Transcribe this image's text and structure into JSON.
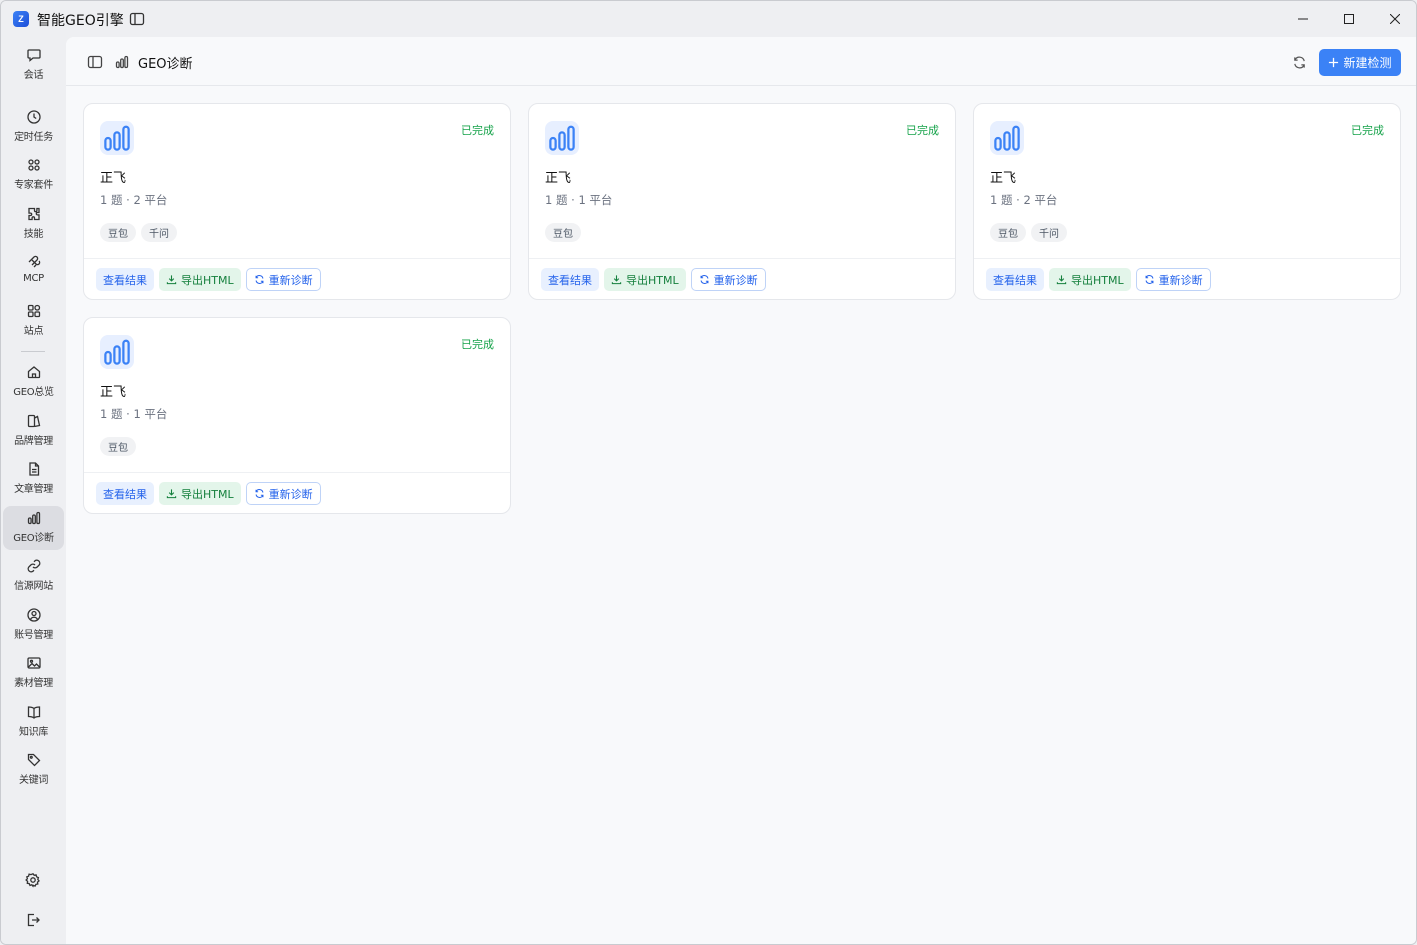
{
  "window": {
    "app_title": "智能GEO引擎",
    "logo_text": "Z"
  },
  "rail": {
    "items": [
      {
        "label": "会话",
        "icon": "chat-icon"
      },
      {
        "label": "定时任务",
        "icon": "clock-icon"
      },
      {
        "label": "专家套件",
        "icon": "grid-icon"
      },
      {
        "label": "技能",
        "icon": "puzzle-icon"
      },
      {
        "label": "MCP",
        "icon": "mcp-icon"
      },
      {
        "label": "站点",
        "icon": "sites-icon"
      },
      {
        "label": "GEO总览",
        "icon": "home-icon"
      },
      {
        "label": "品牌管理",
        "icon": "brand-icon"
      },
      {
        "label": "文章管理",
        "icon": "document-icon"
      },
      {
        "label": "GEO诊断",
        "icon": "bar-chart-icon"
      },
      {
        "label": "信源网站",
        "icon": "link-icon"
      },
      {
        "label": "账号管理",
        "icon": "user-icon"
      },
      {
        "label": "素材管理",
        "icon": "image-icon"
      },
      {
        "label": "知识库",
        "icon": "book-icon"
      },
      {
        "label": "关键词",
        "icon": "tag-icon"
      }
    ],
    "active": "GEO诊断"
  },
  "topbar": {
    "title": "GEO诊断",
    "new_button": "新建检测"
  },
  "cards": [
    {
      "title": "正飞",
      "status": "已完成",
      "meta": "1 题 · 2 平台",
      "tags": [
        "豆包",
        "千问"
      ]
    },
    {
      "title": "正飞",
      "status": "已完成",
      "meta": "1 题 · 1 平台",
      "tags": [
        "豆包"
      ]
    },
    {
      "title": "正飞",
      "status": "已完成",
      "meta": "1 题 · 2 平台",
      "tags": [
        "豆包",
        "千问"
      ]
    },
    {
      "title": "正飞",
      "status": "已完成",
      "meta": "1 题 · 1 平台",
      "tags": [
        "豆包"
      ]
    }
  ],
  "actions": {
    "view": "查看结果",
    "export": "导出HTML",
    "rerun": "重新诊断"
  },
  "colors": {
    "accent": "#3b82f6",
    "status_done": "#16a34a",
    "export_green": "#15803d"
  }
}
